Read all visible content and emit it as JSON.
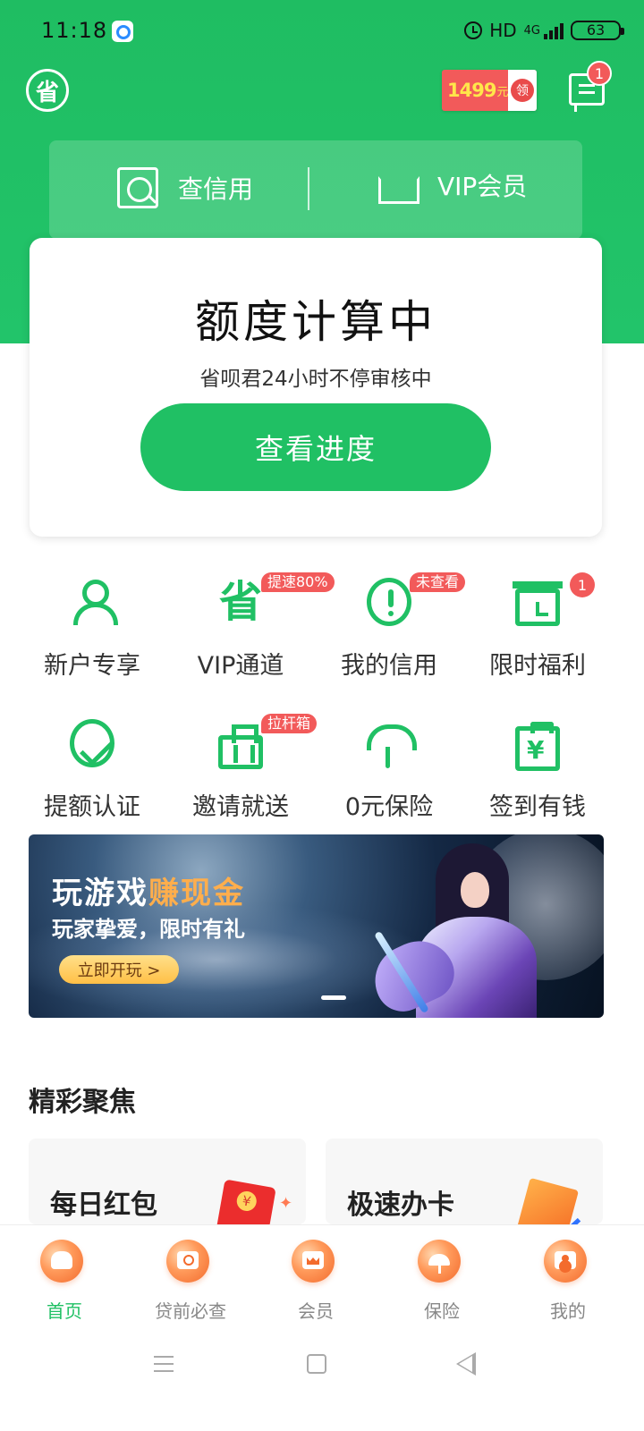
{
  "status_bar": {
    "time": "11:18",
    "hd_label": "HD",
    "network": "4G",
    "battery": "63",
    "icons": [
      "app-notification-icon",
      "alarm-icon",
      "signal-icon",
      "battery-icon"
    ]
  },
  "header": {
    "logo": "省",
    "promo": {
      "amount": "1499",
      "unit": "元",
      "action": "领",
      "colors": {
        "background": "#f25a5a",
        "amount": "#ffe64a"
      }
    },
    "message_badge": "1"
  },
  "quick_actions": [
    {
      "label": "查信用",
      "icon": "credit-search-icon"
    },
    {
      "label": "VIP会员",
      "icon": "crown-icon"
    }
  ],
  "credit_card": {
    "title": "额度计算中",
    "subtitle": "省呗君24小时不停审核中",
    "button": "查看进度"
  },
  "services": [
    {
      "label": "新户专享",
      "icon": "new-user-icon"
    },
    {
      "label": "VIP通道",
      "icon": "vip-channel-icon",
      "tag": "提速80%"
    },
    {
      "label": "我的信用",
      "icon": "credit-alert-icon",
      "tag": "未查看"
    },
    {
      "label": "限时福利",
      "icon": "gift-clock-icon",
      "badge": "1"
    },
    {
      "label": "提额认证",
      "icon": "credit-boost-icon"
    },
    {
      "label": "邀请就送",
      "icon": "luggage-icon",
      "tag": "拉杆箱"
    },
    {
      "label": "0元保险",
      "icon": "umbrella-icon"
    },
    {
      "label": "签到有钱",
      "icon": "checkin-money-icon"
    }
  ],
  "banner": {
    "title_prefix": "玩游戏",
    "title_accent": "赚现金",
    "subtitle": "玩家挚爱，限时有礼",
    "button": "立即开玩 >"
  },
  "section": {
    "title": "精彩聚焦",
    "cards": [
      {
        "title": "每日红包",
        "icon": "red-envelope-icon"
      },
      {
        "title": "极速办卡",
        "icon": "credit-card-icon"
      }
    ]
  },
  "bottom_nav": [
    {
      "label": "首页",
      "icon": "home-icon",
      "active": true
    },
    {
      "label": "贷前必查",
      "icon": "loan-check-icon",
      "active": false
    },
    {
      "label": "会员",
      "icon": "member-crown-icon",
      "active": false
    },
    {
      "label": "保险",
      "icon": "insurance-umbrella-icon",
      "active": false
    },
    {
      "label": "我的",
      "icon": "profile-icon",
      "active": false
    }
  ],
  "theme": {
    "primary": "#20c064",
    "hero": "#1fbd62",
    "alert": "#f25a5a",
    "inactive_text": "#888888"
  }
}
